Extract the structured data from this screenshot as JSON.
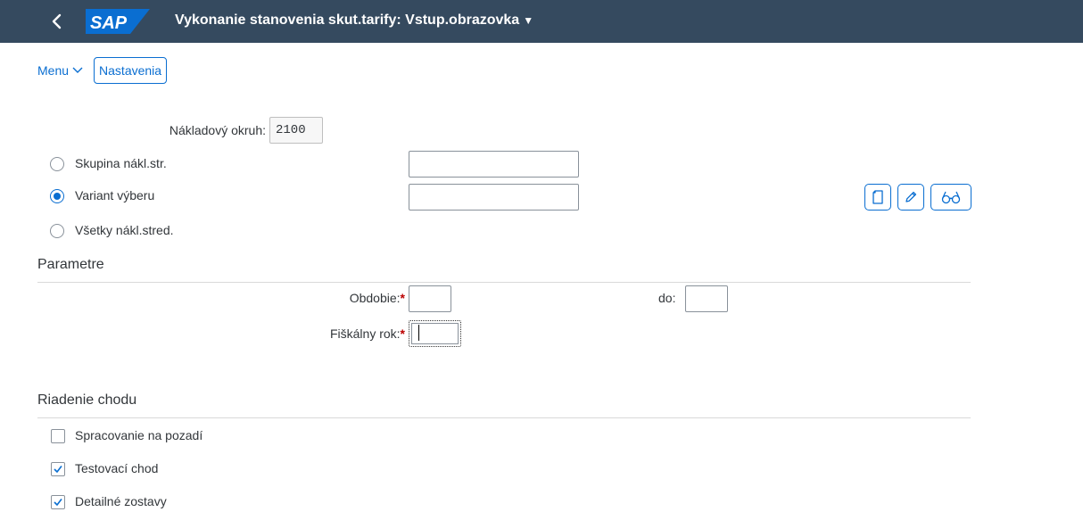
{
  "shell": {
    "logo": "SAP",
    "title": "Vykonanie stanovenia skut.tarify: Vstup.obrazovka",
    "caret": "▼",
    "colors": {
      "shellbar": "#354a5f",
      "logo": "#0a6ed1",
      "accent": "#0a6ed1",
      "required": "#bb0000"
    }
  },
  "toolbar": {
    "menu_label": "Menu",
    "settings_label": "Nastavenia"
  },
  "selection": {
    "cost_area_label": "Nákladový okruh:",
    "cost_area_value": "2100",
    "options": [
      {
        "label": "Skupina nákl.str.",
        "selected": false
      },
      {
        "label": "Variant výberu",
        "selected": true
      },
      {
        "label": "Všetky nákl.stred.",
        "selected": false
      }
    ],
    "variant_buttons": [
      "new-document-icon",
      "edit-pencil-icon",
      "display-glasses-icon"
    ]
  },
  "parameters": {
    "title": "Parametre",
    "period_label": "Obdobie:",
    "required_mark": "*",
    "to_label": "do:",
    "fiscal_year_label": "Fiškálny rok:"
  },
  "run_control": {
    "title": "Riadenie chodu",
    "options": [
      {
        "label": "Spracovanie na pozadí",
        "checked": false
      },
      {
        "label": "Testovací chod",
        "checked": true
      },
      {
        "label": "Detailné zostavy",
        "checked": true
      }
    ]
  }
}
